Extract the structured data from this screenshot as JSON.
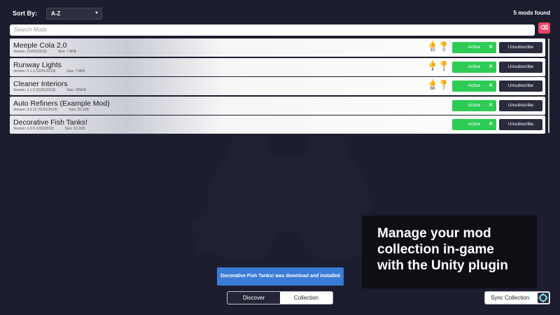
{
  "header": {
    "sort_label": "Sort By:",
    "sort_value": "A-Z",
    "mods_found": "5 mods found"
  },
  "search": {
    "placeholder": "Search Mods",
    "value": ""
  },
  "mods": [
    {
      "name": "Meeple Cola 2.0",
      "version": "Version:   (22/01/2019)",
      "size": "Size: 7.8KB",
      "up": "10",
      "down": "0",
      "status": "Active",
      "action": "Unsubscribe"
    },
    {
      "name": "Runway Lights",
      "version": "Version: 0.1.1 (22/01/2019)",
      "size": "Size: 7.8KB",
      "up": "4",
      "down": "1",
      "status": "Active",
      "action": "Unsubscribe"
    },
    {
      "name": "Cleaner Interiors",
      "version": "Version: 1.1.0 (22/01/2019)",
      "size": "Size: 205KB",
      "up": "66",
      "down": "7",
      "status": "Active",
      "action": "Unsubscribe"
    },
    {
      "name": "Auto Refiners (Example Mod)",
      "version": "Version: 0.0.12 (31/01/2019)",
      "size": "Size: 31.1KB",
      "status": "Active",
      "action": "Unsubscribe"
    },
    {
      "name": "Decorative Fish Tanks!",
      "version": "Version: 1.0.0 (1/02/2019)",
      "size": "Size: 10.1KB",
      "status": "Active",
      "action": "Unsubscribe"
    }
  ],
  "promo": {
    "line1": "Manage your mod",
    "line2": "collection in-game",
    "line3": "with the Unity plugin"
  },
  "toast": "Decorative Fish Tanks! was download and installed",
  "tabs": {
    "discover": "Discover",
    "collection": "Collection"
  },
  "sync_label": "Sync Collection",
  "colors": {
    "background": "#1c1d2e",
    "active_green": "#2ecc55",
    "dark_button": "#2a2b3d",
    "toast_blue": "#3a7bd5",
    "clear_red": "#e8456a"
  },
  "icons": {
    "clear_search": "backspace-icon",
    "thumbs_up": "thumbs-up-icon",
    "thumbs_down": "thumbs-down-icon",
    "close": "close-icon",
    "sync": "modio-logo-icon"
  }
}
